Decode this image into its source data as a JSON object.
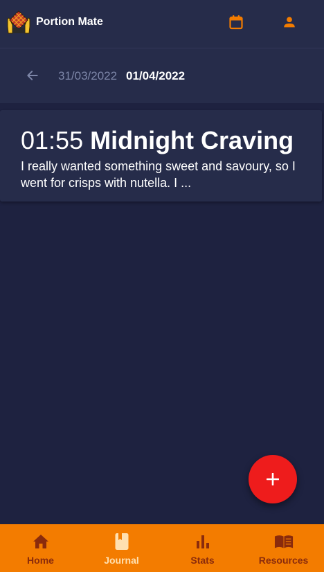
{
  "app": {
    "title": "Portion Mate"
  },
  "date_nav": {
    "previous_date": "31/03/2022",
    "current_date": "01/04/2022"
  },
  "entries": [
    {
      "time": "01:55",
      "title": "Midnight Craving",
      "excerpt": "I really wanted something sweet and savoury, so I went for crisps with nutella. I ..."
    }
  ],
  "fab": {
    "label": "+"
  },
  "bottom_nav": {
    "items": [
      {
        "label": "Home",
        "icon": "home-icon",
        "active": false
      },
      {
        "label": "Journal",
        "icon": "journal-icon",
        "active": true
      },
      {
        "label": "Stats",
        "icon": "bar-chart-icon",
        "active": false
      },
      {
        "label": "Resources",
        "icon": "book-icon",
        "active": false
      }
    ]
  },
  "colors": {
    "background": "#1e2240",
    "surface": "#262c4a",
    "accent": "#f37c00",
    "fab": "#ee1c1c",
    "nav_inactive": "#8a2b0c",
    "nav_active": "#ffe0b0",
    "muted_text": "#7d86a8"
  }
}
